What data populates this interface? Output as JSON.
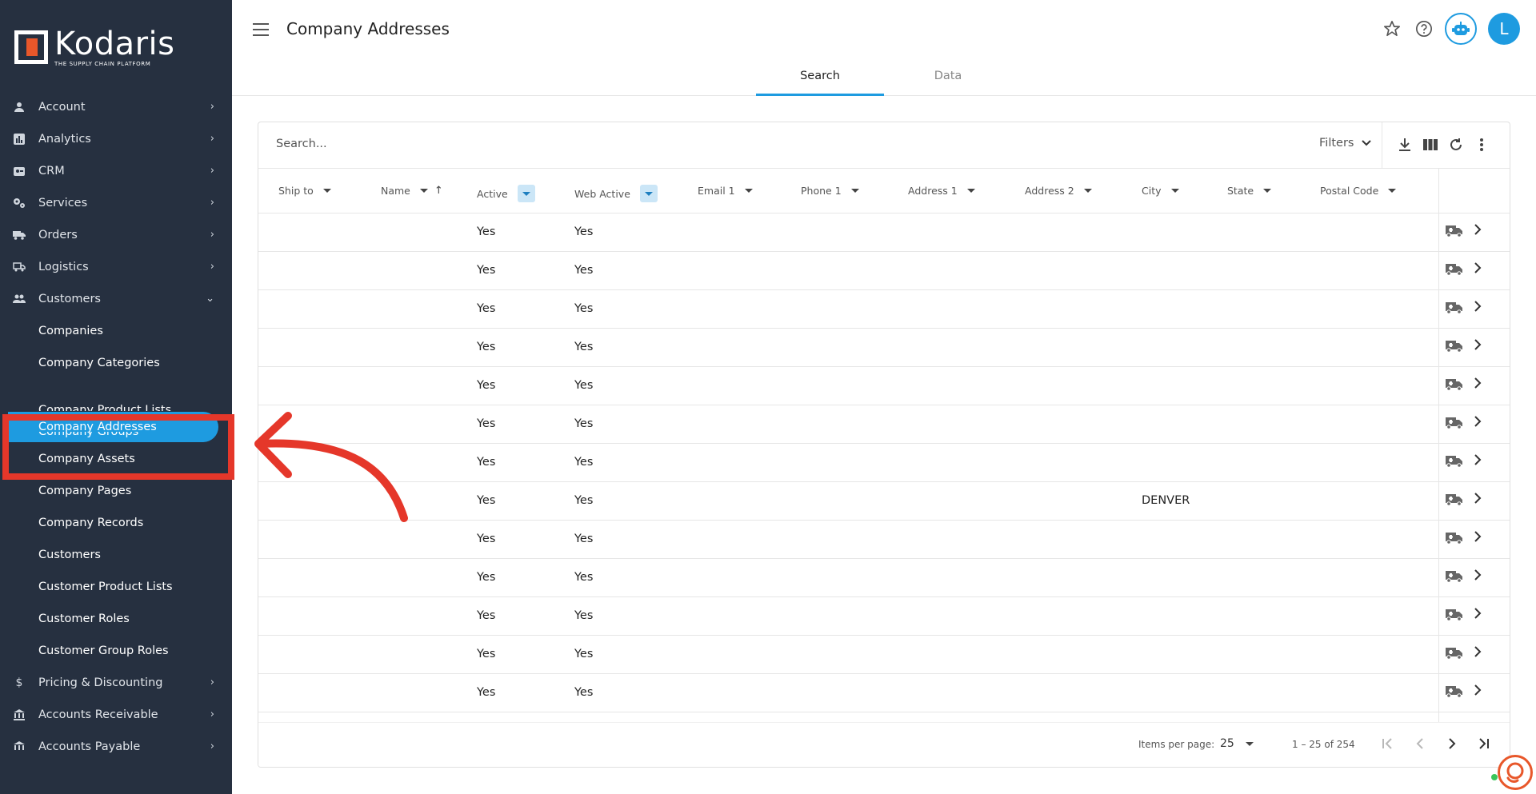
{
  "brand": {
    "name": "Kodaris",
    "tagline": "THE SUPPLY CHAIN PLATFORM",
    "accent": "#1e9be0",
    "logo_orange": "#e8572a"
  },
  "sidebar": {
    "items": [
      {
        "label": "Account",
        "icon": "account-icon",
        "expanded": false
      },
      {
        "label": "Analytics",
        "icon": "analytics-icon",
        "expanded": false
      },
      {
        "label": "CRM",
        "icon": "crm-icon",
        "expanded": false
      },
      {
        "label": "Services",
        "icon": "services-icon",
        "expanded": false
      },
      {
        "label": "Orders",
        "icon": "truck-icon",
        "expanded": false
      },
      {
        "label": "Logistics",
        "icon": "logistics-icon",
        "expanded": false
      },
      {
        "label": "Customers",
        "icon": "people-icon",
        "expanded": true
      }
    ],
    "customers_sub": [
      "Companies",
      "Company Categories",
      "Company Product Lists",
      "Company Addresses",
      "Company Groups",
      "Company Assets",
      "Company Pages",
      "Company Records",
      "Customers",
      "Customer Product Lists",
      "Customer Roles",
      "Customer Group Roles"
    ],
    "active_sub": "Company Addresses",
    "bottom_items": [
      {
        "label": "Pricing & Discounting",
        "icon": "dollar-icon"
      },
      {
        "label": "Accounts Receivable",
        "icon": "bank-icon"
      },
      {
        "label": "Accounts Payable",
        "icon": "bank-icon"
      }
    ]
  },
  "header": {
    "title": "Company Addresses",
    "tabs": [
      {
        "label": "Search",
        "active": true
      },
      {
        "label": "Data",
        "active": false
      }
    ],
    "avatar_letter": "L"
  },
  "search": {
    "placeholder": "Search...",
    "filters_label": "Filters"
  },
  "table": {
    "columns": [
      {
        "label": "Ship to",
        "filter_active": false
      },
      {
        "label": "Name",
        "filter_active": false,
        "sorted": "asc"
      },
      {
        "label": "Active",
        "filter_active": true
      },
      {
        "label": "Web Active",
        "filter_active": true
      },
      {
        "label": "Email 1",
        "filter_active": false
      },
      {
        "label": "Phone 1",
        "filter_active": false
      },
      {
        "label": "Address 1",
        "filter_active": false
      },
      {
        "label": "Address 2",
        "filter_active": false
      },
      {
        "label": "City",
        "filter_active": false
      },
      {
        "label": "State",
        "filter_active": false
      },
      {
        "label": "Postal Code",
        "filter_active": false
      }
    ],
    "rows": [
      {
        "active": "Yes",
        "web_active": "Yes",
        "city": ""
      },
      {
        "active": "Yes",
        "web_active": "Yes",
        "city": ""
      },
      {
        "active": "Yes",
        "web_active": "Yes",
        "city": ""
      },
      {
        "active": "Yes",
        "web_active": "Yes",
        "city": ""
      },
      {
        "active": "Yes",
        "web_active": "Yes",
        "city": ""
      },
      {
        "active": "Yes",
        "web_active": "Yes",
        "city": ""
      },
      {
        "active": "Yes",
        "web_active": "Yes",
        "city": ""
      },
      {
        "active": "Yes",
        "web_active": "Yes",
        "city": "DENVER"
      },
      {
        "active": "Yes",
        "web_active": "Yes",
        "city": ""
      },
      {
        "active": "Yes",
        "web_active": "Yes",
        "city": ""
      },
      {
        "active": "Yes",
        "web_active": "Yes",
        "city": ""
      },
      {
        "active": "Yes",
        "web_active": "Yes",
        "city": ""
      },
      {
        "active": "Yes",
        "web_active": "Yes",
        "city": ""
      }
    ]
  },
  "pagination": {
    "items_per_page_label": "Items per page:",
    "items_per_page": "25",
    "range": "1 – 25 of 254"
  },
  "annotation": {
    "color": "#e5372a"
  }
}
